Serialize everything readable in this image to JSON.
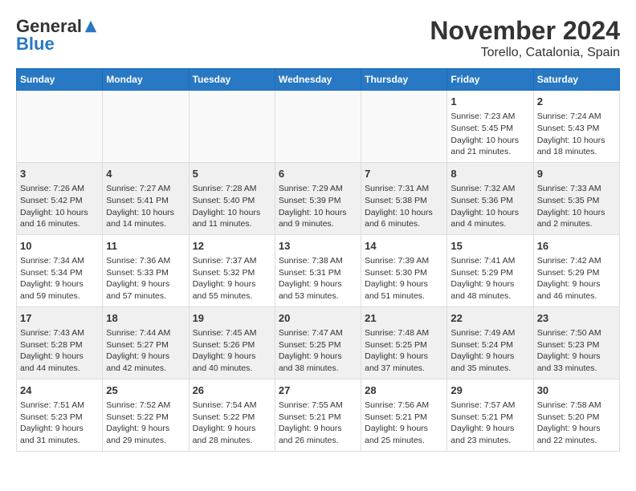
{
  "logo": {
    "general": "General",
    "blue": "Blue"
  },
  "title": "November 2024",
  "subtitle": "Torello, Catalonia, Spain",
  "days_of_week": [
    "Sunday",
    "Monday",
    "Tuesday",
    "Wednesday",
    "Thursday",
    "Friday",
    "Saturday"
  ],
  "weeks": [
    [
      {
        "day": "",
        "content": ""
      },
      {
        "day": "",
        "content": ""
      },
      {
        "day": "",
        "content": ""
      },
      {
        "day": "",
        "content": ""
      },
      {
        "day": "",
        "content": ""
      },
      {
        "day": "1",
        "content": "Sunrise: 7:23 AM\nSunset: 5:45 PM\nDaylight: 10 hours\nand 21 minutes."
      },
      {
        "day": "2",
        "content": "Sunrise: 7:24 AM\nSunset: 5:43 PM\nDaylight: 10 hours\nand 18 minutes."
      }
    ],
    [
      {
        "day": "3",
        "content": "Sunrise: 7:26 AM\nSunset: 5:42 PM\nDaylight: 10 hours\nand 16 minutes."
      },
      {
        "day": "4",
        "content": "Sunrise: 7:27 AM\nSunset: 5:41 PM\nDaylight: 10 hours\nand 14 minutes."
      },
      {
        "day": "5",
        "content": "Sunrise: 7:28 AM\nSunset: 5:40 PM\nDaylight: 10 hours\nand 11 minutes."
      },
      {
        "day": "6",
        "content": "Sunrise: 7:29 AM\nSunset: 5:39 PM\nDaylight: 10 hours\nand 9 minutes."
      },
      {
        "day": "7",
        "content": "Sunrise: 7:31 AM\nSunset: 5:38 PM\nDaylight: 10 hours\nand 6 minutes."
      },
      {
        "day": "8",
        "content": "Sunrise: 7:32 AM\nSunset: 5:36 PM\nDaylight: 10 hours\nand 4 minutes."
      },
      {
        "day": "9",
        "content": "Sunrise: 7:33 AM\nSunset: 5:35 PM\nDaylight: 10 hours\nand 2 minutes."
      }
    ],
    [
      {
        "day": "10",
        "content": "Sunrise: 7:34 AM\nSunset: 5:34 PM\nDaylight: 9 hours\nand 59 minutes."
      },
      {
        "day": "11",
        "content": "Sunrise: 7:36 AM\nSunset: 5:33 PM\nDaylight: 9 hours\nand 57 minutes."
      },
      {
        "day": "12",
        "content": "Sunrise: 7:37 AM\nSunset: 5:32 PM\nDaylight: 9 hours\nand 55 minutes."
      },
      {
        "day": "13",
        "content": "Sunrise: 7:38 AM\nSunset: 5:31 PM\nDaylight: 9 hours\nand 53 minutes."
      },
      {
        "day": "14",
        "content": "Sunrise: 7:39 AM\nSunset: 5:30 PM\nDaylight: 9 hours\nand 51 minutes."
      },
      {
        "day": "15",
        "content": "Sunrise: 7:41 AM\nSunset: 5:29 PM\nDaylight: 9 hours\nand 48 minutes."
      },
      {
        "day": "16",
        "content": "Sunrise: 7:42 AM\nSunset: 5:29 PM\nDaylight: 9 hours\nand 46 minutes."
      }
    ],
    [
      {
        "day": "17",
        "content": "Sunrise: 7:43 AM\nSunset: 5:28 PM\nDaylight: 9 hours\nand 44 minutes."
      },
      {
        "day": "18",
        "content": "Sunrise: 7:44 AM\nSunset: 5:27 PM\nDaylight: 9 hours\nand 42 minutes."
      },
      {
        "day": "19",
        "content": "Sunrise: 7:45 AM\nSunset: 5:26 PM\nDaylight: 9 hours\nand 40 minutes."
      },
      {
        "day": "20",
        "content": "Sunrise: 7:47 AM\nSunset: 5:25 PM\nDaylight: 9 hours\nand 38 minutes."
      },
      {
        "day": "21",
        "content": "Sunrise: 7:48 AM\nSunset: 5:25 PM\nDaylight: 9 hours\nand 37 minutes."
      },
      {
        "day": "22",
        "content": "Sunrise: 7:49 AM\nSunset: 5:24 PM\nDaylight: 9 hours\nand 35 minutes."
      },
      {
        "day": "23",
        "content": "Sunrise: 7:50 AM\nSunset: 5:23 PM\nDaylight: 9 hours\nand 33 minutes."
      }
    ],
    [
      {
        "day": "24",
        "content": "Sunrise: 7:51 AM\nSunset: 5:23 PM\nDaylight: 9 hours\nand 31 minutes."
      },
      {
        "day": "25",
        "content": "Sunrise: 7:52 AM\nSunset: 5:22 PM\nDaylight: 9 hours\nand 29 minutes."
      },
      {
        "day": "26",
        "content": "Sunrise: 7:54 AM\nSunset: 5:22 PM\nDaylight: 9 hours\nand 28 minutes."
      },
      {
        "day": "27",
        "content": "Sunrise: 7:55 AM\nSunset: 5:21 PM\nDaylight: 9 hours\nand 26 minutes."
      },
      {
        "day": "28",
        "content": "Sunrise: 7:56 AM\nSunset: 5:21 PM\nDaylight: 9 hours\nand 25 minutes."
      },
      {
        "day": "29",
        "content": "Sunrise: 7:57 AM\nSunset: 5:21 PM\nDaylight: 9 hours\nand 23 minutes."
      },
      {
        "day": "30",
        "content": "Sunrise: 7:58 AM\nSunset: 5:20 PM\nDaylight: 9 hours\nand 22 minutes."
      }
    ]
  ]
}
